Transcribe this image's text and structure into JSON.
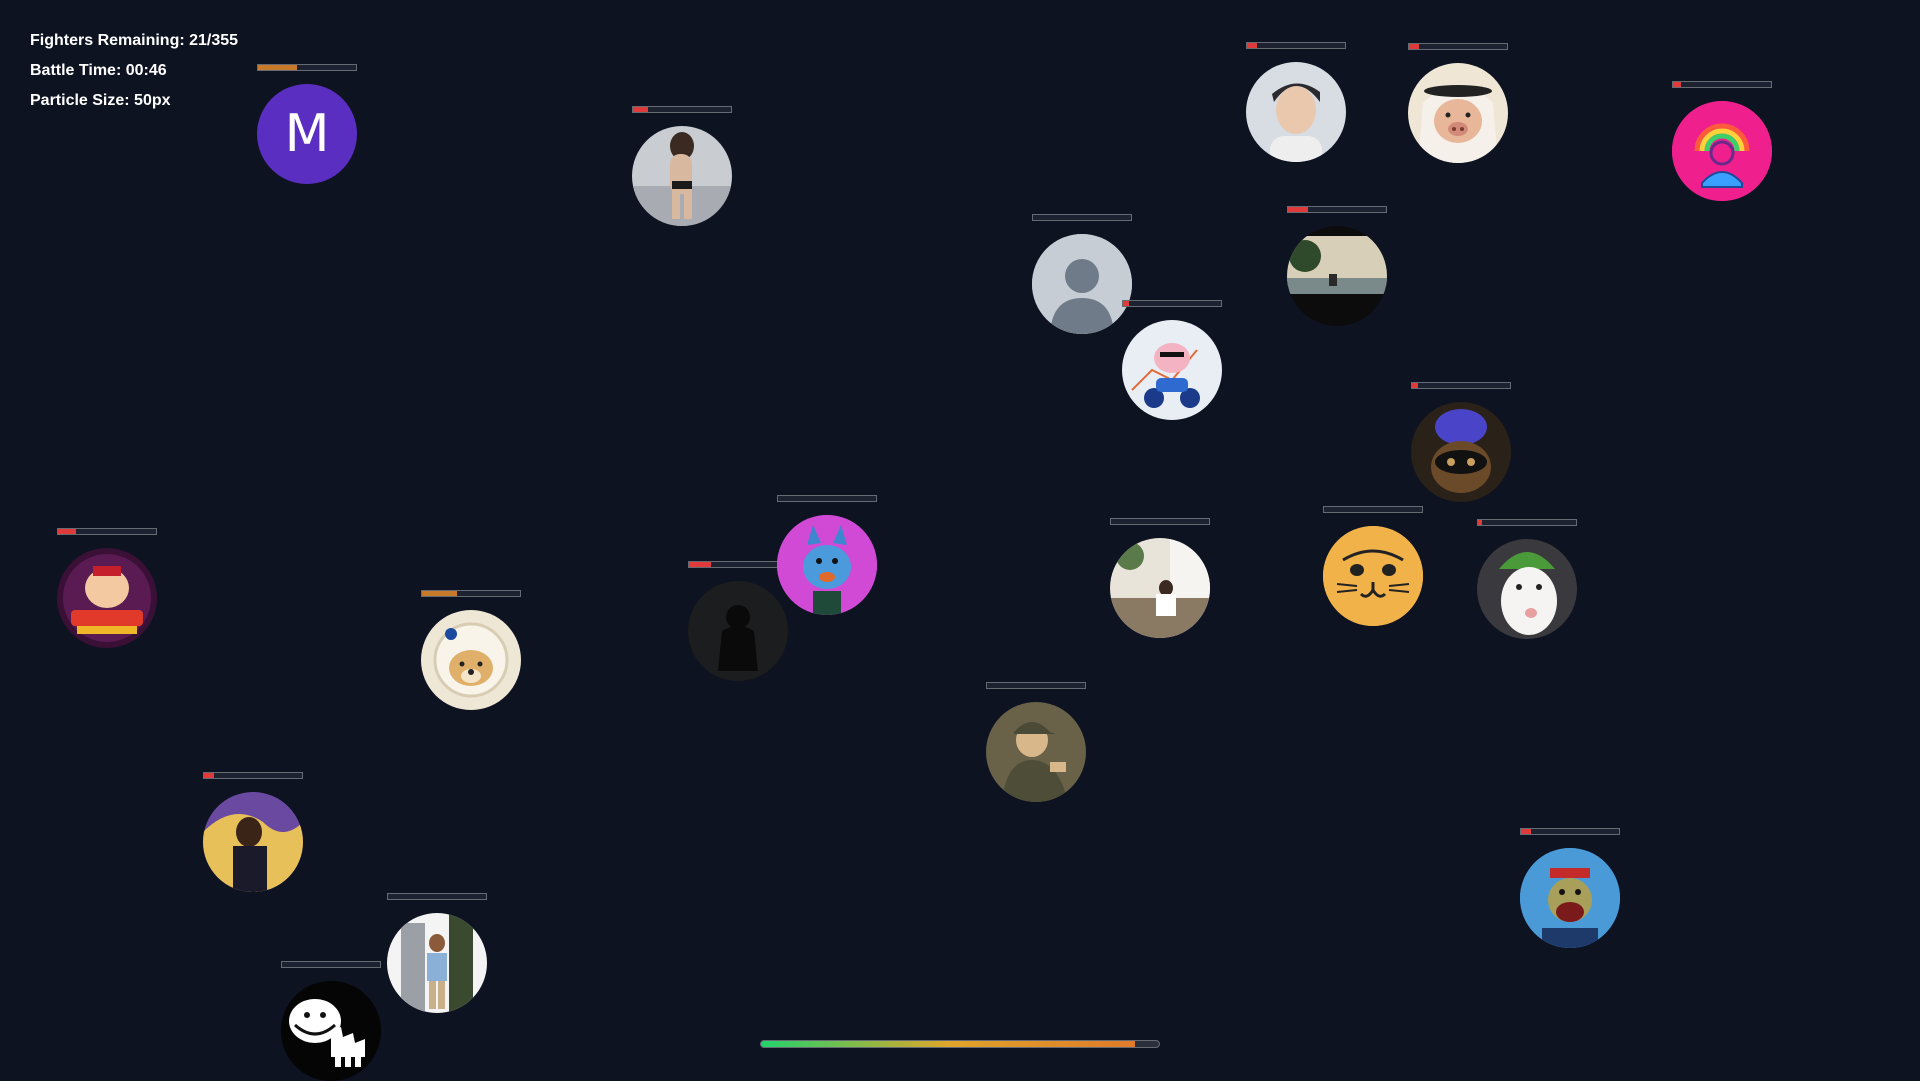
{
  "hud": {
    "fighters_remaining": "Fighters Remaining: 21/355",
    "battle_time": "Battle Time: 00:46",
    "particle_size": "Particle Size: 50px"
  },
  "fighters": [
    {
      "id": "m-purple",
      "avatar": "letter M",
      "letter": "M",
      "health": 0.4
    },
    {
      "id": "beach-woman",
      "avatar": "photo",
      "health": 0.15
    },
    {
      "id": "boy-portrait",
      "avatar": "photo",
      "health": 0.1
    },
    {
      "id": "pig-headdress",
      "avatar": "illustration",
      "health": 0.1
    },
    {
      "id": "rainbow-person",
      "avatar": "rainbow-smile-icon",
      "health": 0.08
    },
    {
      "id": "default-profile",
      "avatar": "default-user-icon",
      "health": 0.0
    },
    {
      "id": "lake-sitter",
      "avatar": "photo",
      "health": 0.2
    },
    {
      "id": "pig-motorbike",
      "avatar": "illustration",
      "health": 0.06
    },
    {
      "id": "blue-octopus-cat",
      "avatar": "illustration",
      "health": 0.06
    },
    {
      "id": "wrestler-reverse",
      "avatar": "illustration",
      "health": 0.18
    },
    {
      "id": "doge-astronaut",
      "avatar": "illustration",
      "health": 0.36
    },
    {
      "id": "shadow-beast",
      "avatar": "photo",
      "health": 0.22
    },
    {
      "id": "blue-cat-cartoon",
      "avatar": "illustration",
      "health": 0.0
    },
    {
      "id": "man-courtyard",
      "avatar": "photo",
      "health": 0.0
    },
    {
      "id": "yellow-cat-face",
      "avatar": "illustration",
      "health": 0.0
    },
    {
      "id": "dog-watermelon",
      "avatar": "photo",
      "health": 0.04
    },
    {
      "id": "cap-man",
      "avatar": "illustration",
      "health": 0.0
    },
    {
      "id": "ape-propeller",
      "avatar": "illustration",
      "health": 0.1
    },
    {
      "id": "party-man",
      "avatar": "photo",
      "health": 0.1
    },
    {
      "id": "man-glass-door",
      "avatar": "photo",
      "health": 0.0
    },
    {
      "id": "troll-face",
      "avatar": "troll-face-icon",
      "health": 0.0
    }
  ],
  "colors": {
    "background": "#0e1322",
    "hp_low": "#e03a3a",
    "hp_mid": "#c77a2a",
    "progress_start": "#22d36b",
    "progress_end": "#e07a2a"
  },
  "battle_progress": 0.94
}
